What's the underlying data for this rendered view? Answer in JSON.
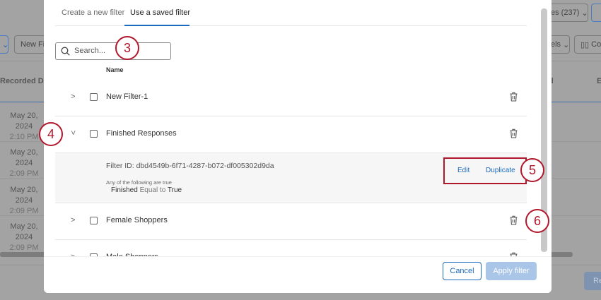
{
  "background": {
    "responses_button": "es (237)",
    "new_filter_button": "New Fi",
    "labels_button": "els",
    "columns_button": "Co",
    "col_recorded": "Recorded Dat",
    "col_right1": "d",
    "col_right2": "E",
    "rows": [
      {
        "date": "May 20, 2024",
        "time": "2:10 PM"
      },
      {
        "date": "May 20, 2024",
        "time": "2:09 PM"
      },
      {
        "date": "May 20, 2024",
        "time": "2:09 PM"
      },
      {
        "date": "May 20, 2024",
        "time": "2:09 PM"
      }
    ],
    "bottom_button": "Re"
  },
  "modal": {
    "tabs": [
      {
        "label": "Create a new filter"
      },
      {
        "label": "Use a saved filter",
        "active": true
      }
    ],
    "search_placeholder": "Search...",
    "name_header": "Name",
    "filters": [
      {
        "name": "New Filter-1"
      },
      {
        "name": "Finished Responses",
        "expanded": true
      },
      {
        "name": "Female Shoppers"
      },
      {
        "name": "Male Shoppers"
      }
    ],
    "details": {
      "filter_id": "Filter ID: dbd4549b-6f71-4287-b072-df005302d9da",
      "condition_intro": "Any of the following are true",
      "field": "Finished",
      "operator": "Equal to",
      "value": "True",
      "edit": "Edit",
      "duplicate": "Duplicate"
    },
    "cancel": "Cancel",
    "apply": "Apply filter"
  },
  "callouts": [
    "3",
    "4",
    "5",
    "6"
  ],
  "colors": {
    "accent": "#1a6bbf",
    "callout": "#b1172a",
    "apply_disabled": "#a9c5e8"
  }
}
